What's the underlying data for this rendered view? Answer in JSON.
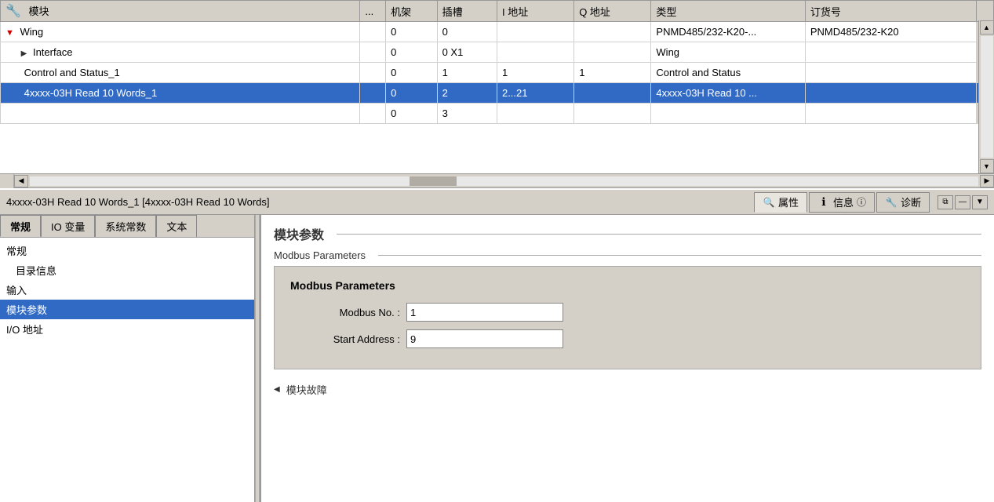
{
  "table": {
    "columns": [
      "模块",
      "...",
      "机架",
      "插槽",
      "I 地址",
      "Q 地址",
      "类型",
      "订货号"
    ],
    "rows": [
      {
        "module": "Wing",
        "dots": "",
        "rack": "0",
        "slot": "0",
        "iaddr": "",
        "qaddr": "",
        "type": "PNMD485/232-K20-...",
        "order": "PNMD485/232-K20",
        "level": 1,
        "hasArrow": true,
        "arrowDown": true,
        "highlighted": false
      },
      {
        "module": "Interface",
        "dots": "",
        "rack": "0",
        "slot": "0 X1",
        "iaddr": "",
        "qaddr": "",
        "type": "Wing",
        "order": "",
        "level": 2,
        "hasArrow": true,
        "arrowDown": false,
        "highlighted": false
      },
      {
        "module": "Control and Status_1",
        "dots": "",
        "rack": "0",
        "slot": "1",
        "iaddr": "1",
        "qaddr": "1",
        "type": "Control and Status",
        "order": "",
        "level": 1,
        "hasArrow": false,
        "arrowDown": false,
        "highlighted": false
      },
      {
        "module": "4xxxx-03H Read 10 Words_1",
        "dots": "",
        "rack": "0",
        "slot": "2",
        "iaddr": "2...21",
        "qaddr": "",
        "type": "4xxxx-03H Read 10 ...",
        "order": "",
        "level": 1,
        "hasArrow": false,
        "arrowDown": false,
        "highlighted": true
      },
      {
        "module": "",
        "dots": "",
        "rack": "0",
        "slot": "3",
        "iaddr": "",
        "qaddr": "",
        "type": "",
        "order": "",
        "level": 0,
        "hasArrow": false,
        "arrowDown": false,
        "highlighted": false
      }
    ]
  },
  "panel": {
    "title": "4xxxx-03H Read 10 Words_1 [4xxxx-03H Read 10 Words]",
    "tabs_right": [
      {
        "label": "属性",
        "icon": "🔍",
        "active": true
      },
      {
        "label": "信息",
        "icon": "ℹ",
        "active": false
      },
      {
        "label": "诊断",
        "icon": "🔧",
        "active": false
      }
    ]
  },
  "left_tabs": [
    "常规",
    "IO 变量",
    "系统常数",
    "文本"
  ],
  "left_nav": [
    {
      "label": "常规",
      "level": 0,
      "selected": false
    },
    {
      "label": "目录信息",
      "level": 1,
      "selected": false
    },
    {
      "label": "输入",
      "level": 0,
      "selected": false
    },
    {
      "label": "模块参数",
      "level": 0,
      "selected": true
    },
    {
      "label": "I/O 地址",
      "level": 0,
      "selected": false
    }
  ],
  "right_panel": {
    "main_title": "模块参数",
    "subsection_label": "Modbus Parameters",
    "modbus_box": {
      "title": "Modbus Parameters",
      "fields": [
        {
          "label": "Modbus No. :",
          "value": "1"
        },
        {
          "label": "Start Address :",
          "value": "9"
        }
      ]
    },
    "bottom_label": "模块故障"
  }
}
